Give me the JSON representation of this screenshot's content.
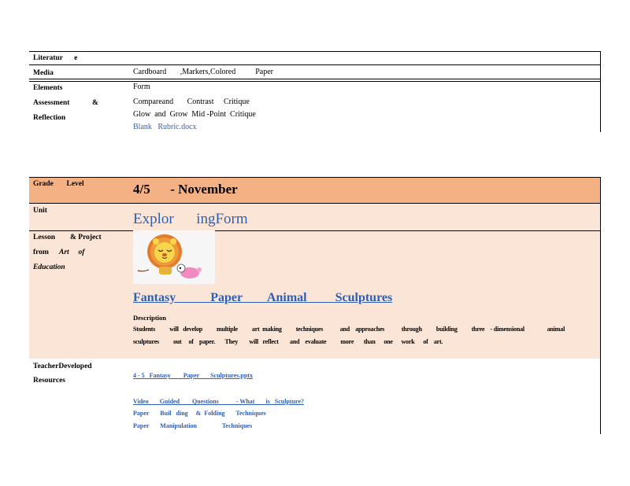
{
  "top_table": {
    "literature_label": "Literatur      e",
    "media_label": "Media",
    "media_value": "Cardboard       ,Markers,Colored          Paper",
    "elements_label": "Elements",
    "elements_value": "Form",
    "assessment_label_1": "Assessment            &",
    "assessment_label_2": "Reflection",
    "assessment_value_1": "Compareand       Contrast     Critique",
    "assessment_value_2": "Glow  and  Grow  Mid -Point  Critique",
    "assessment_link": "Blank   Rubric.docx"
  },
  "plan_table": {
    "grade_label": "Grade       Level",
    "grade_value": "4/5      - November",
    "unit_label": "Unit",
    "unit_value": "Explor      ingForm",
    "lesson_label_1": "Lesson        & Project",
    "lesson_label_2a": "from",
    "lesson_label_2b": "Art     of",
    "lesson_label_3": "Education",
    "lesson_title": "Fantasy           Paper        Animal         Sculptures",
    "description_heading": "Description",
    "description_line1": "Students          will   develop          multiple          art  making          techniques            and    approaches            through          building          three    - dimensional                animal",
    "description_line2": "sculptures          out     of    paper.       They        will   reflect        and    evaluate          more       than      one      work      of    art.",
    "resources_label_1": "TeacherDeveloped",
    "resources_label_2": "Resources",
    "resource_links": [
      "4 - 5   Fantasy        Paper       Sculptures.pptx",
      "Video       Guided        Questions           - What       is   Sculpture?",
      "Paper       Buil   ding     &  Folding       Techniques",
      "Paper       Manipulation                Techniques"
    ]
  },
  "colors": {
    "header_band": "#f4b183",
    "light_band": "#fbe5d6",
    "link": "#2f5fb3"
  }
}
